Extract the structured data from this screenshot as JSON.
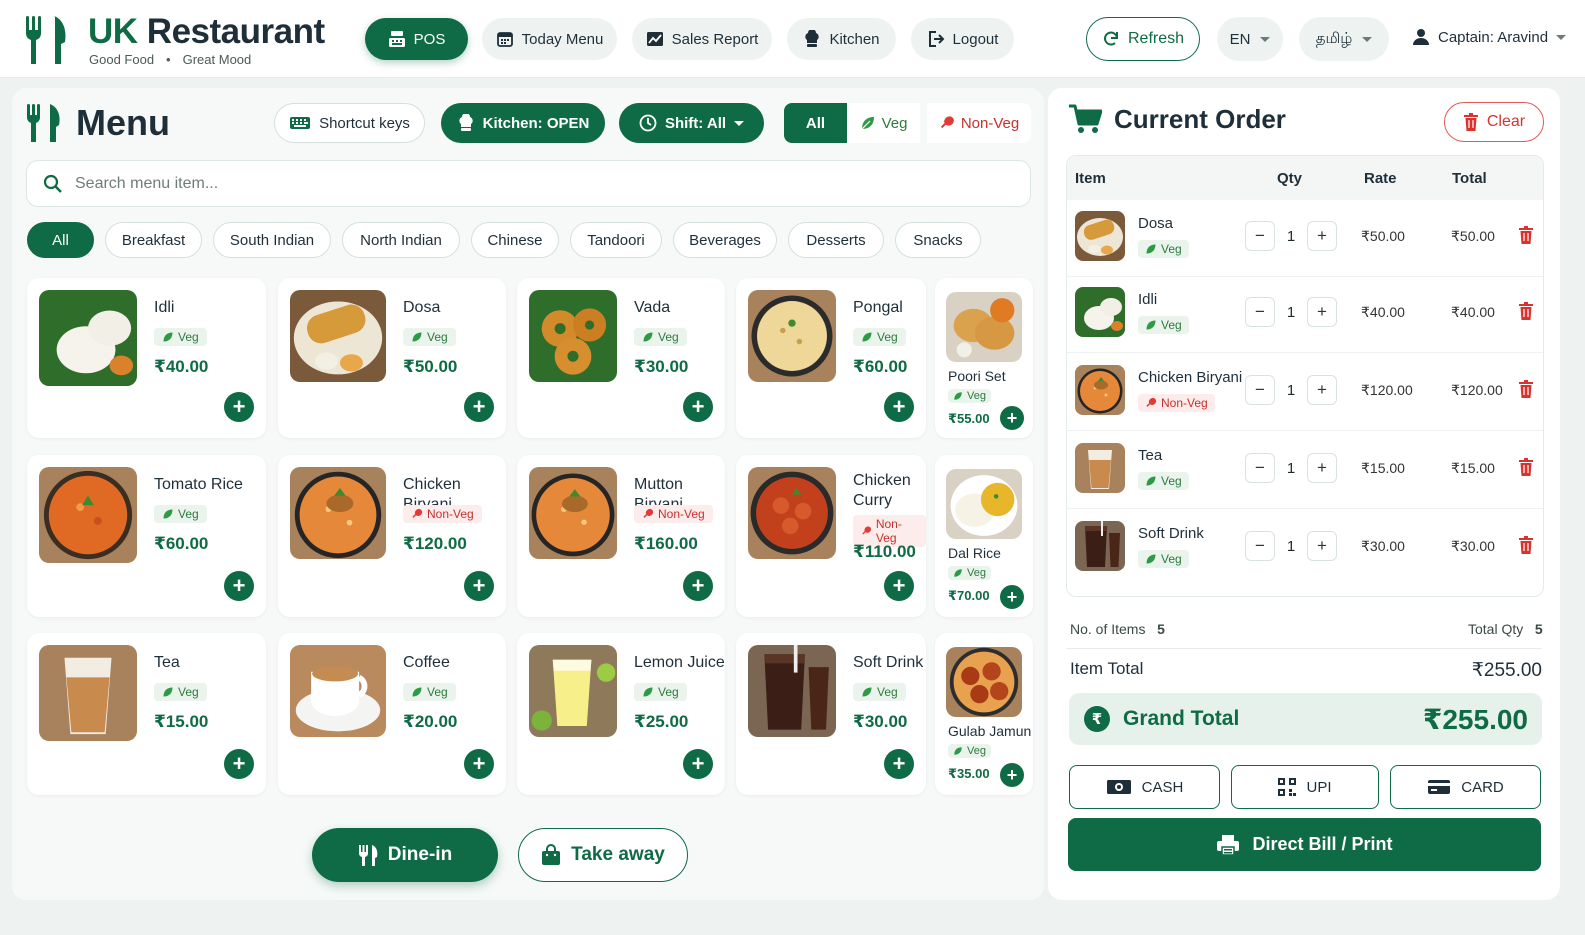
{
  "brand": {
    "name_part1": "UK",
    "name_part2": "Restaurant",
    "tagline_1": "Good Food",
    "tagline_sep": "•",
    "tagline_2": "Great Mood"
  },
  "nav": {
    "pos": "POS",
    "today_menu": "Today Menu",
    "sales_report": "Sales Report",
    "kitchen": "Kitchen",
    "logout": "Logout"
  },
  "header_right": {
    "refresh": "Refresh",
    "lang_en": "EN",
    "lang_ta": "தமிழ்",
    "captain": "Captain: Aravind"
  },
  "menu": {
    "title": "Menu",
    "shortcut_keys": "Shortcut keys",
    "kitchen_status": "Kitchen: OPEN",
    "shift": "Shift: All",
    "filter_all": "All",
    "filter_veg": "Veg",
    "filter_nonveg": "Non-Veg",
    "search_placeholder": "Search menu item...",
    "categories": [
      "All",
      "Breakfast",
      "South Indian",
      "North Indian",
      "Chinese",
      "Tandoori",
      "Beverages",
      "Desserts",
      "Snacks"
    ],
    "items": [
      {
        "name": "Idli",
        "type": "Veg",
        "price": "₹40.00",
        "food": "idli"
      },
      {
        "name": "Dosa",
        "type": "Veg",
        "price": "₹50.00",
        "food": "dosa"
      },
      {
        "name": "Vada",
        "type": "Veg",
        "price": "₹30.00",
        "food": "vada"
      },
      {
        "name": "Pongal",
        "type": "Veg",
        "price": "₹60.00",
        "food": "pongal"
      },
      {
        "name": "Poori Set",
        "type": "Veg",
        "price": "₹55.00",
        "food": "poori"
      },
      {
        "name": "Tomato Rice",
        "type": "Veg",
        "price": "₹60.00",
        "food": "rice"
      },
      {
        "name": "Chicken Biryani",
        "type": "Non-Veg",
        "price": "₹120.00",
        "food": "biryani"
      },
      {
        "name": "Mutton Biryani",
        "type": "Non-Veg",
        "price": "₹160.00",
        "food": "biryani"
      },
      {
        "name_line1": "Chicken",
        "name_line2": "Curry",
        "type": "Non-Veg",
        "price": "₹110.00",
        "food": "curry"
      },
      {
        "name": "Dal Rice",
        "type": "Veg",
        "price": "₹70.00",
        "food": "dal"
      },
      {
        "name": "Tea",
        "type": "Veg",
        "price": "₹15.00",
        "food": "tea"
      },
      {
        "name": "Coffee",
        "type": "Veg",
        "price": "₹20.00",
        "food": "coffee"
      },
      {
        "name": "Lemon Juice",
        "type": "Veg",
        "price": "₹25.00",
        "food": "lemon"
      },
      {
        "name": "Soft Drink",
        "type": "Veg",
        "price": "₹30.00",
        "food": "cola"
      },
      {
        "name": "Gulab Jamun",
        "type": "Veg",
        "price": "₹35.00",
        "food": "jamun"
      }
    ],
    "dine_in": "Dine-in",
    "take_away": "Take away"
  },
  "order": {
    "title": "Current Order",
    "clear": "Clear",
    "columns": {
      "item": "Item",
      "qty": "Qty",
      "rate": "Rate",
      "total": "Total"
    },
    "rows": [
      {
        "name": "Dosa",
        "type": "Veg",
        "qty": "1",
        "rate": "₹50.00",
        "total": "₹50.00",
        "food": "dosa"
      },
      {
        "name": "Idli",
        "type": "Veg",
        "qty": "1",
        "rate": "₹40.00",
        "total": "₹40.00",
        "food": "idli"
      },
      {
        "name": "Chicken Biryani",
        "type": "Non-Veg",
        "qty": "1",
        "rate": "₹120.00",
        "total": "₹120.00",
        "food": "biryani"
      },
      {
        "name": "Tea",
        "type": "Veg",
        "qty": "1",
        "rate": "₹15.00",
        "total": "₹15.00",
        "food": "tea"
      },
      {
        "name": "Soft Drink",
        "type": "Veg",
        "qty": "1",
        "rate": "₹30.00",
        "total": "₹30.00",
        "food": "cola"
      }
    ],
    "no_of_items_label": "No. of Items",
    "no_of_items": "5",
    "total_qty_label": "Total Qty",
    "total_qty": "5",
    "item_total_label": "Item Total",
    "item_total": "₹255.00",
    "grand_total_label": "Grand Total",
    "grand_total": "₹255.00",
    "cash": "CASH",
    "upi": "UPI",
    "card": "CARD",
    "print": "Direct Bill / Print"
  },
  "colors": {
    "primary": "#0f6b45",
    "veg": "#2d7a3d",
    "nonveg": "#c8302c",
    "danger": "#d8332e"
  }
}
